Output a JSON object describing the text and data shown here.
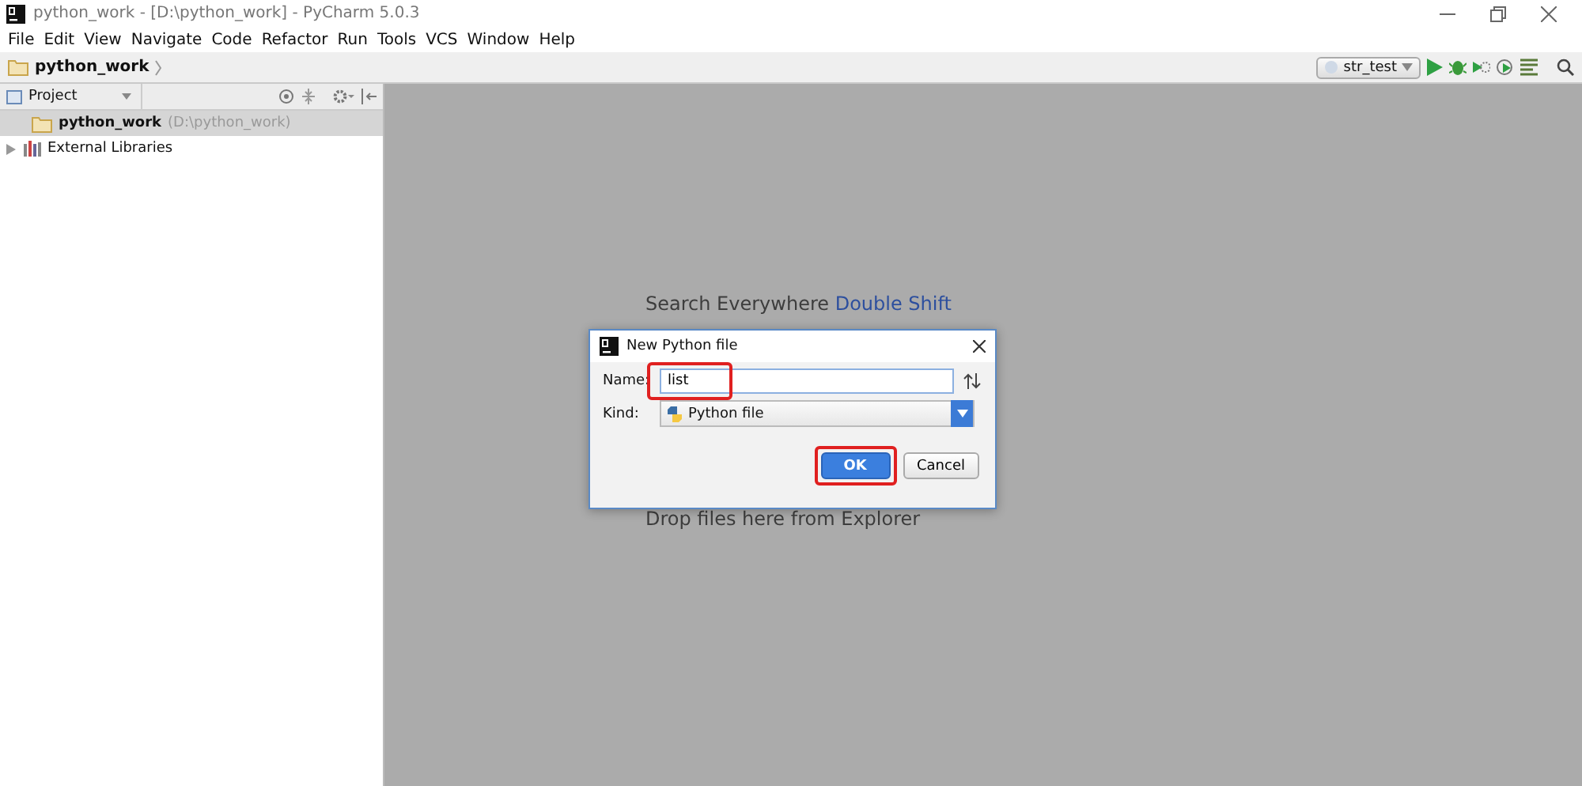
{
  "window": {
    "title": "python_work - [D:\\python_work] - PyCharm 5.0.3"
  },
  "menu": [
    "File",
    "Edit",
    "View",
    "Navigate",
    "Code",
    "Refactor",
    "Run",
    "Tools",
    "VCS",
    "Window",
    "Help"
  ],
  "nav_bar": {
    "breadcrumb": "python_work",
    "run_config": "str_test"
  },
  "project_panel": {
    "title": "Project",
    "tree": [
      {
        "label": "python_work",
        "path": "(D:\\python_work)",
        "kind": "folder",
        "selected": true
      },
      {
        "label": "External Libraries",
        "kind": "library",
        "selected": false,
        "expanded": false
      }
    ]
  },
  "editor_hints": [
    {
      "text": "Search Everywhere",
      "shortcut": "Double Shift"
    },
    {
      "text": "Drop files here from Explorer"
    }
  ],
  "dialog": {
    "title": "New Python file",
    "name_field": {
      "label": "Name:",
      "value": "list",
      "highlighted": true
    },
    "kind_field": {
      "label": "Kind:",
      "value": "Python file"
    },
    "buttons": [
      {
        "label": "OK",
        "default": true,
        "highlighted": true
      },
      {
        "label": "Cancel",
        "default": false,
        "highlighted": false
      }
    ]
  }
}
